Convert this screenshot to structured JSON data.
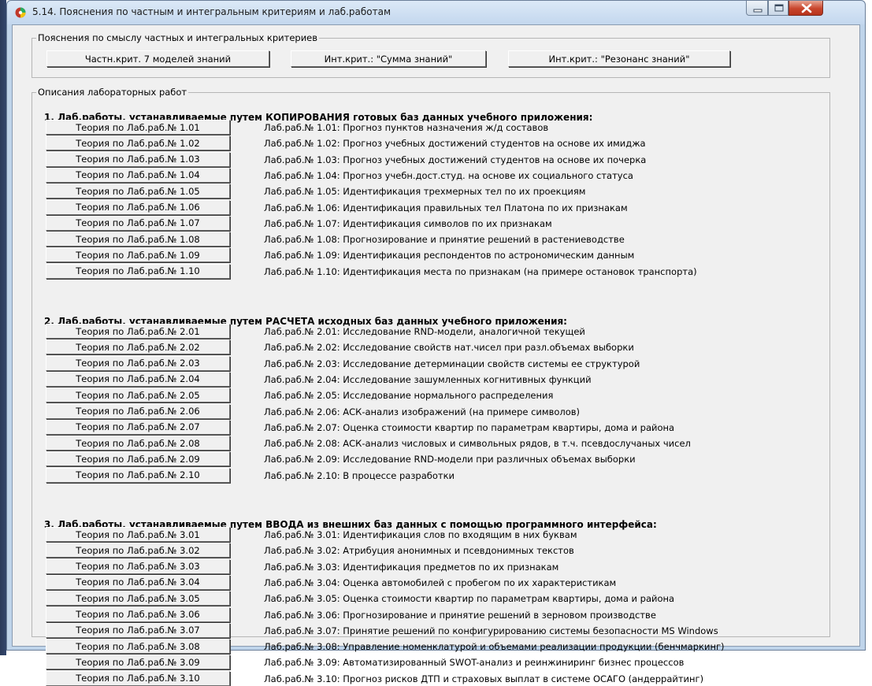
{
  "window": {
    "title": "5.14. Пояснения по частным и интегральным критериям и лаб.работам"
  },
  "criteria_group": {
    "label": "Пояснения по смыслу частных и интегральных критериев",
    "buttons": [
      "Частн.крит. 7 моделей знаний",
      "Инт.крит.: \"Сумма знаний\"",
      "Инт.крит.: \"Резонанс знаний\""
    ]
  },
  "labs_group": {
    "label": "Описания лабораторных работ",
    "sections": [
      {
        "title": "1. Лаб.работы, устанавливаемые путем КОПИРОВАНИЯ готовых баз данных учебного приложения:",
        "rows": [
          {
            "button": "Теория по Лаб.раб.№ 1.01",
            "desc": "Лаб.раб.№ 1.01: Прогноз пунктов назначения ж/д составов"
          },
          {
            "button": "Теория по Лаб.раб.№ 1.02",
            "desc": "Лаб.раб.№ 1.02: Прогноз учебных достижений студентов на основе их имиджа"
          },
          {
            "button": "Теория по Лаб.раб.№ 1.03",
            "desc": "Лаб.раб.№ 1.03: Прогноз учебных достижений студентов на основе их почерка"
          },
          {
            "button": "Теория по Лаб.раб.№ 1.04",
            "desc": "Лаб.раб.№ 1.04: Прогноз учебн.дост.студ. на основе их социального статуса"
          },
          {
            "button": "Теория по Лаб.раб.№ 1.05",
            "desc": "Лаб.раб.№ 1.05: Идентификация трехмерных тел по их проекциям"
          },
          {
            "button": "Теория по Лаб.раб.№ 1.06",
            "desc": "Лаб.раб.№ 1.06: Идентификация правильных тел Платона по их признакам"
          },
          {
            "button": "Теория по Лаб.раб.№ 1.07",
            "desc": "Лаб.раб.№ 1.07: Идентификация символов по их признакам"
          },
          {
            "button": "Теория по Лаб.раб.№ 1.08",
            "desc": "Лаб.раб.№ 1.08: Прогнозирование и принятие решений в растениеводстве"
          },
          {
            "button": "Теория по Лаб.раб.№ 1.09",
            "desc": "Лаб.раб.№ 1.09: Идентификация респондентов по астрономическим данным"
          },
          {
            "button": "Теория по Лаб.раб.№ 1.10",
            "desc": "Лаб.раб.№ 1.10: Идентификация места по признакам (на примере остановок транспорта)"
          }
        ]
      },
      {
        "title": "2. Лаб.работы, устанавливаемые путем РАСЧЕТА исходных баз данных учебного приложения:",
        "rows": [
          {
            "button": "Теория по Лаб.раб.№ 2.01",
            "desc": "Лаб.раб.№ 2.01: Исследование RND-модели, аналогичной текущей"
          },
          {
            "button": "Теория по Лаб.раб.№ 2.02",
            "desc": "Лаб.раб.№ 2.02: Исследование свойств нат.чисел при разл.объемах выборки"
          },
          {
            "button": "Теория по Лаб.раб.№ 2.03",
            "desc": "Лаб.раб.№ 2.03: Исследование детерминации свойств системы ее структурой"
          },
          {
            "button": "Теория по Лаб.раб.№ 2.04",
            "desc": "Лаб.раб.№ 2.04: Исследование зашумленных когнитивных функций"
          },
          {
            "button": "Теория по Лаб.раб.№ 2.05",
            "desc": "Лаб.раб.№ 2.05: Исследование нормального распределения"
          },
          {
            "button": "Теория по Лаб.раб.№ 2.06",
            "desc": "Лаб.раб.№ 2.06: АСК-анализ изображений (на примере символов)"
          },
          {
            "button": "Теория по Лаб.раб.№ 2.07",
            "desc": "Лаб.раб.№ 2.07: Оценка стоимости квартир по параметрам квартиры, дома и района"
          },
          {
            "button": "Теория по Лаб.раб.№ 2.08",
            "desc": "Лаб.раб.№ 2.08: АСК-анализ числовых и символьных рядов, в т.ч. псевдослучаных чисел"
          },
          {
            "button": "Теория по Лаб.раб.№ 2.09",
            "desc": "Лаб.раб.№ 2.09: Исследование RND-модели при различных объемах выборки"
          },
          {
            "button": "Теория по Лаб.раб.№ 2.10",
            "desc": "Лаб.раб.№ 2.10: В процессе разработки"
          }
        ]
      },
      {
        "title": "3. Лаб.работы, устанавливаемые путем ВВОДА из внешних баз данных с помощью программного интерфейса:",
        "rows": [
          {
            "button": "Теория по Лаб.раб.№ 3.01",
            "desc": "Лаб.раб.№ 3.01: Идентификация слов по входящим в них буквам"
          },
          {
            "button": "Теория по Лаб.раб.№ 3.02",
            "desc": "Лаб.раб.№ 3.02: Атрибуция анонимных и псевдонимных текстов"
          },
          {
            "button": "Теория по Лаб.раб.№ 3.03",
            "desc": "Лаб.раб.№ 3.03: Идентификация предметов по их признакам"
          },
          {
            "button": "Теория по Лаб.раб.№ 3.04",
            "desc": "Лаб.раб.№ 3.04: Оценка автомобилей с пробегом по их характеристикам"
          },
          {
            "button": "Теория по Лаб.раб.№ 3.05",
            "desc": "Лаб.раб.№ 3.05: Оценка стоимости квартир по параметрам квартиры, дома и района"
          },
          {
            "button": "Теория по Лаб.раб.№ 3.06",
            "desc": "Лаб.раб.№ 3.06: Прогнозирование и принятие решений в зерновом производстве"
          },
          {
            "button": "Теория по Лаб.раб.№ 3.07",
            "desc": "Лаб.раб.№ 3.07: Принятие решений по конфигурированию системы безопасности MS Windows"
          },
          {
            "button": "Теория по Лаб.раб.№ 3.08",
            "desc": "Лаб.раб.№ 3.08: Управление номенклатурой и объемами реализации продукции (бенчмаркинг)"
          },
          {
            "button": "Теория по Лаб.раб.№ 3.09",
            "desc": "Лаб.раб.№ 3.09: Автоматизированный SWOT-анализ и реинжиниринг бизнес процессов"
          },
          {
            "button": "Теория по Лаб.раб.№ 3.10",
            "desc": "Лаб.раб.№ 3.10: Прогноз рисков ДТП и страховых выплат в системе ОСАГО (андеррайтинг)"
          }
        ]
      }
    ]
  }
}
